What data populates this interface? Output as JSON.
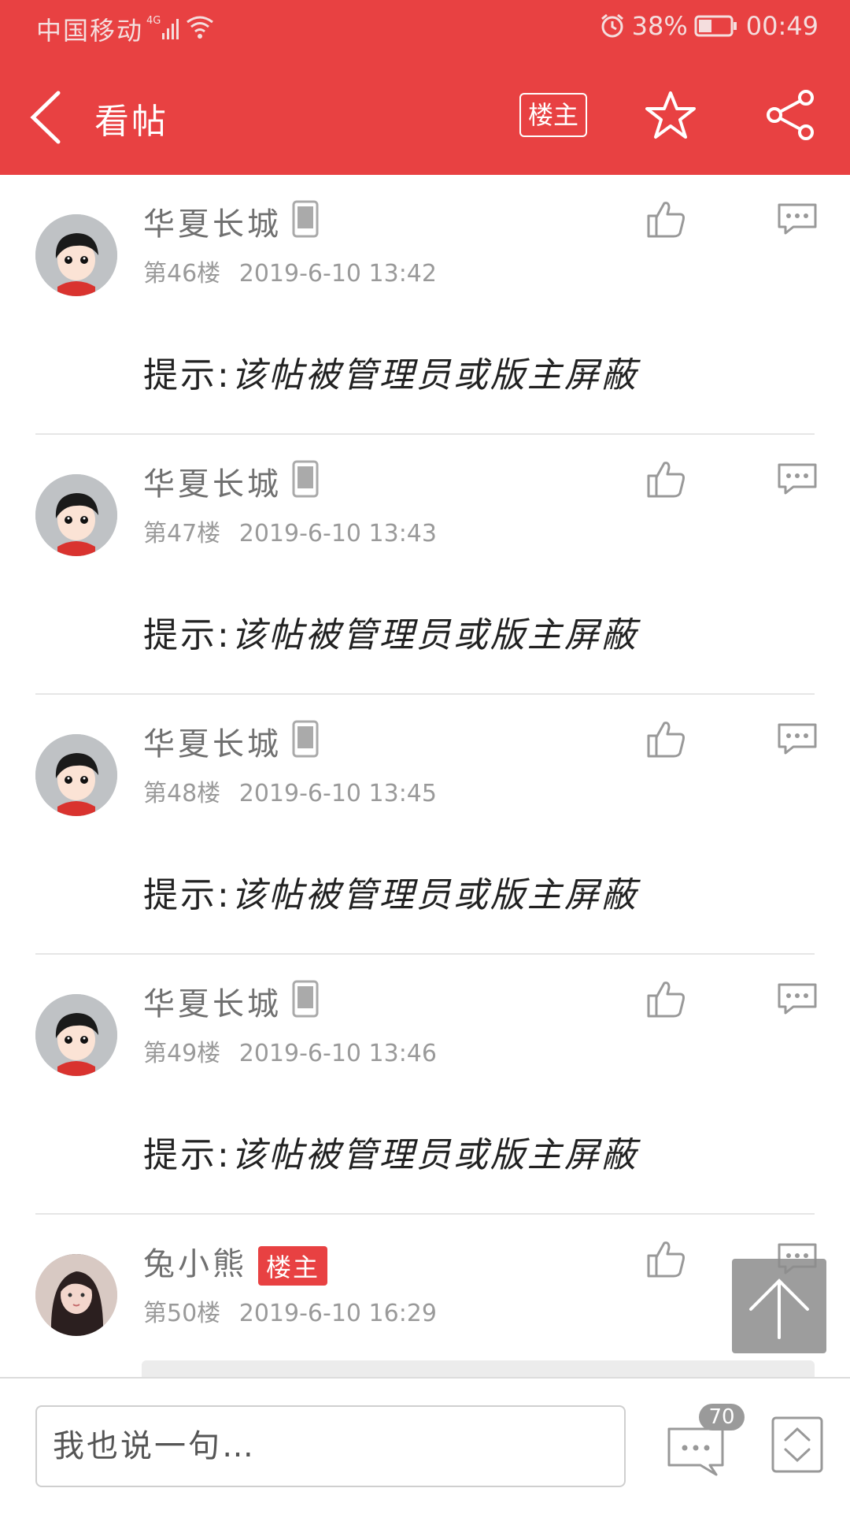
{
  "status_bar": {
    "carrier": "中国移动",
    "network": "4G",
    "battery": "38%",
    "time": "00:49"
  },
  "header": {
    "title": "看帖",
    "op_filter_label": "楼主",
    "icons": [
      "back-icon",
      "star-icon",
      "share-icon"
    ]
  },
  "posts": [
    {
      "author": "华夏长城",
      "floor": "第46楼",
      "time": "2019-6-10 13:42",
      "notice_prefix": "提示:",
      "notice": "该帖被管理员或版主屏蔽"
    },
    {
      "author": "华夏长城",
      "floor": "第47楼",
      "time": "2019-6-10 13:43",
      "notice_prefix": "提示:",
      "notice": "该帖被管理员或版主屏蔽"
    },
    {
      "author": "华夏长城",
      "floor": "第48楼",
      "time": "2019-6-10 13:45",
      "notice_prefix": "提示:",
      "notice": "该帖被管理员或版主屏蔽"
    },
    {
      "author": "华夏长城",
      "floor": "第49楼",
      "time": "2019-6-10 13:46",
      "notice_prefix": "提示:",
      "notice": "该帖被管理员或版主屏蔽"
    },
    {
      "author": "兔小熊",
      "op_tag": "楼主",
      "floor": "第50楼",
      "time": "2019-6-10 16:29"
    }
  ],
  "bottom_bar": {
    "reply_placeholder": "我也说一句…",
    "comment_count": "70"
  },
  "colors": {
    "accent": "#e84142",
    "muted_text": "#9a9a9a",
    "body_text": "#222222"
  }
}
